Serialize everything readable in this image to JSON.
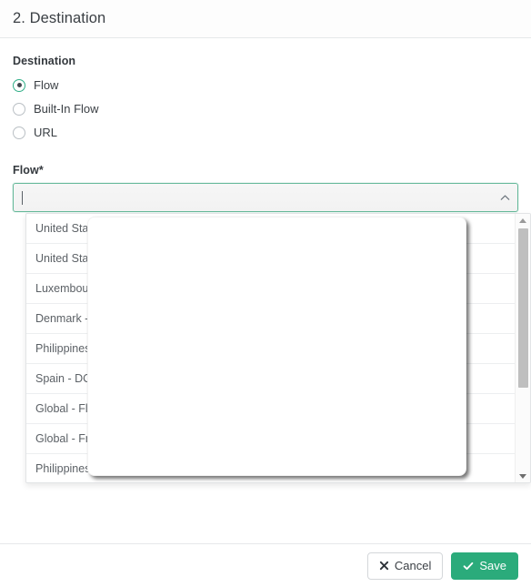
{
  "header": {
    "title": "2. Destination"
  },
  "form": {
    "destination": {
      "label": "Destination",
      "options": [
        {
          "label": "Flow",
          "selected": true
        },
        {
          "label": "Built-In Flow",
          "selected": false
        },
        {
          "label": "URL",
          "selected": false
        }
      ]
    },
    "flow": {
      "label": "Flow*",
      "value": "",
      "placeholder": "",
      "expanded": true,
      "caret_icon": "chevron-up-icon"
    }
  },
  "dropdown": {
    "items": [
      "United States",
      "United States",
      "Luxembourg",
      "Denmark - Ac",
      "Philippines - I",
      "Spain - DC Ca",
      "Global - Flow",
      "Global - FreeW",
      "Philippines - K"
    ],
    "scrollbar": {
      "up_arrow_icon": "caret-up-icon",
      "down_arrow_icon": "caret-down-icon"
    }
  },
  "footer": {
    "cancel_label": "Cancel",
    "cancel_icon": "close-x-icon",
    "save_label": "Save",
    "save_icon": "check-icon"
  },
  "colors": {
    "accent_green": "#2bab7b",
    "focus_border": "#66b99a",
    "text": "#34393e",
    "muted_text": "#5c6166",
    "border": "#e6e8ea"
  }
}
